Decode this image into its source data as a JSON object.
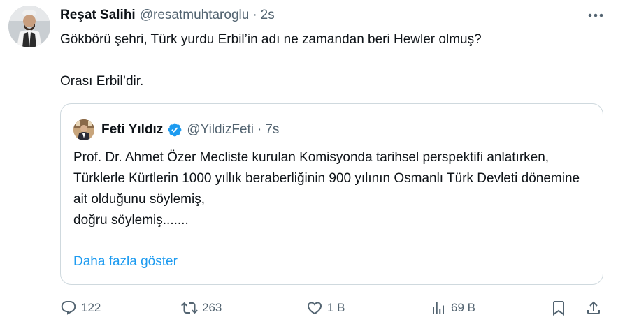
{
  "author": {
    "name": "Reşat Salihi",
    "handle": "@resatmuhtaroglu",
    "separator": "·",
    "time": "2s",
    "avatar_icon": "avatar-photo-icon"
  },
  "tweet": {
    "text": "Gökbörü şehri, Türk yurdu Erbil’in adı ne zamandan beri Hewler olmuş?\n\nOrası Erbil’dir."
  },
  "quote": {
    "name": "Feti Yıldız",
    "handle": "@YildizFeti",
    "separator": "·",
    "time": "7s",
    "verified_color": "#1d9bf0",
    "text": "Prof. Dr. Ahmet Özer Mecliste kurulan Komisyonda tarihsel perspektifi anlatırken,\nTürklerle Kürtlerin 1000 yıllık beraberliğinin 900  yılının Osmanlı Türk Devleti dönemine ait olduğunu söylemiş,\ndoğru söylemiş.......",
    "show_more": "Daha fazla göster"
  },
  "actions": {
    "replies": "122",
    "retweets": "263",
    "likes": "1 B",
    "views": "69 B"
  },
  "colors": {
    "text": "#0f1419",
    "secondary": "#536471",
    "accent": "#1d9bf0",
    "border": "#cfd9de"
  }
}
